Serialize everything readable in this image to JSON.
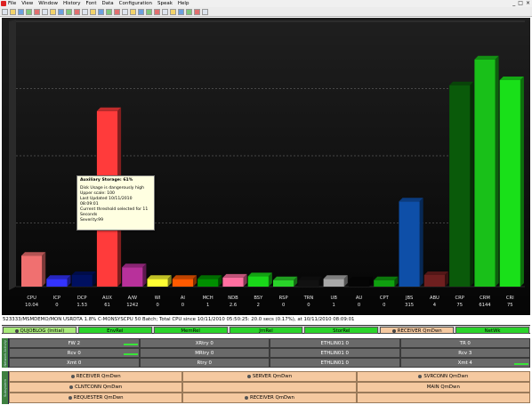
{
  "menu": [
    "File",
    "View",
    "Window",
    "History",
    "Font",
    "Data",
    "Configuration",
    "Speak",
    "Help"
  ],
  "window_controls": [
    "_",
    "□",
    "×"
  ],
  "toolbar_icons": [
    "open-icon",
    "save-icon",
    "print-icon",
    "cut-icon",
    "copy-icon",
    "paste-icon",
    "find-icon",
    "refresh-icon",
    "chart-icon",
    "table-icon",
    "filter-icon",
    "zoom-in-icon",
    "zoom-out-icon",
    "sort-icon",
    "color-icon",
    "settings-icon",
    "alert-icon",
    "help-icon",
    "graph-icon",
    "grid-icon",
    "export-icon",
    "import-icon",
    "home-icon",
    "stop-icon",
    "play-icon",
    "info-icon"
  ],
  "chart_data": {
    "type": "bar",
    "categories": [
      "CPU",
      "ICP",
      "DCP",
      "AUX",
      "A/W",
      "WI",
      "AI",
      "MCH",
      "NDB",
      "BSY",
      "RSP",
      "TRN",
      "UB",
      "AU",
      "CPT",
      "JBS",
      "ABU",
      "CRP",
      "CRM",
      "CRI"
    ],
    "value_labels": [
      "10.04",
      "0",
      "1.53",
      "61",
      "1242",
      "0",
      "0",
      "1",
      "2.6",
      "2",
      "0",
      "0",
      "1",
      "0",
      "0",
      "315",
      "4",
      "75",
      "6144",
      "75"
    ],
    "heights_pct": [
      12,
      3,
      4.5,
      68,
      7.5,
      3,
      3,
      3,
      3.5,
      4,
      2.5,
      2.5,
      3,
      2.5,
      2.5,
      33,
      4.5,
      78,
      88,
      80
    ],
    "colors": [
      "#f07070",
      "#3333ff",
      "#001060",
      "#ff3b3b",
      "#b8319b",
      "#ffff33",
      "#ff5a00",
      "#009000",
      "#ff6fa0",
      "#19d719",
      "#29d329",
      "#111111",
      "#a8a8a8",
      "#050505",
      "#0fa00f",
      "#0e4fa8",
      "#6e1f1f",
      "#0a5a0a",
      "#19c019",
      "#19e019"
    ]
  },
  "tooltip": {
    "title": "Auxiliary Storage: 61%",
    "lines": [
      "Disk Usage is dangerously high",
      "Upper scale: 100",
      "Last Updated 10/11/2010 08:09:01",
      "Current threshold selected for 11 Seconds",
      "Severity:99"
    ]
  },
  "status_text": "523333/MSMDEMO/MON USRDTA 1.8% C-MONSYSCPU 50 Batch; Total CPU since 10/11/2010 05:50:25: 20.0 secs (0.17%), at 10/11/2010 08:09:01",
  "objects_row": [
    {
      "label": "QUJOBLOG (Initial)",
      "style": "sel",
      "icon": true
    },
    {
      "label": "EnvRel",
      "style": "",
      "icon": false
    },
    {
      "label": "MemRel",
      "style": "",
      "icon": false
    },
    {
      "label": "JrnRel",
      "style": "",
      "icon": false
    },
    {
      "label": "StorRel",
      "style": "",
      "icon": false
    },
    {
      "label": "RECEIVER QmDwn",
      "style": "warn",
      "icon": true
    },
    {
      "label": "NetWk",
      "style": "",
      "icon": false
    }
  ],
  "network_gutter": "Network Activity",
  "network_rows": [
    [
      "FW 2",
      "XRtry 0",
      "ETHLIN01 0",
      "TR 0"
    ],
    [
      "Rcv 0",
      "MRtry 0",
      "ETHLIN01 0",
      "Rcv 3"
    ],
    [
      "Xmt 0",
      "Rtry 0",
      "ETHLIN01 0",
      "Xmt 4"
    ]
  ],
  "subsystem_gutter": "Subsystem",
  "subsystem_rows": [
    [
      "RECEIVER QmDwn",
      "SERVER QmDwn",
      "SVRCONN QmDwn"
    ],
    [
      "CLNTCONN QmDwn",
      "",
      "MAIN QmDwn"
    ],
    [
      "REQUESTER QmDwn",
      "RECEIVER QmDwn",
      ""
    ]
  ]
}
